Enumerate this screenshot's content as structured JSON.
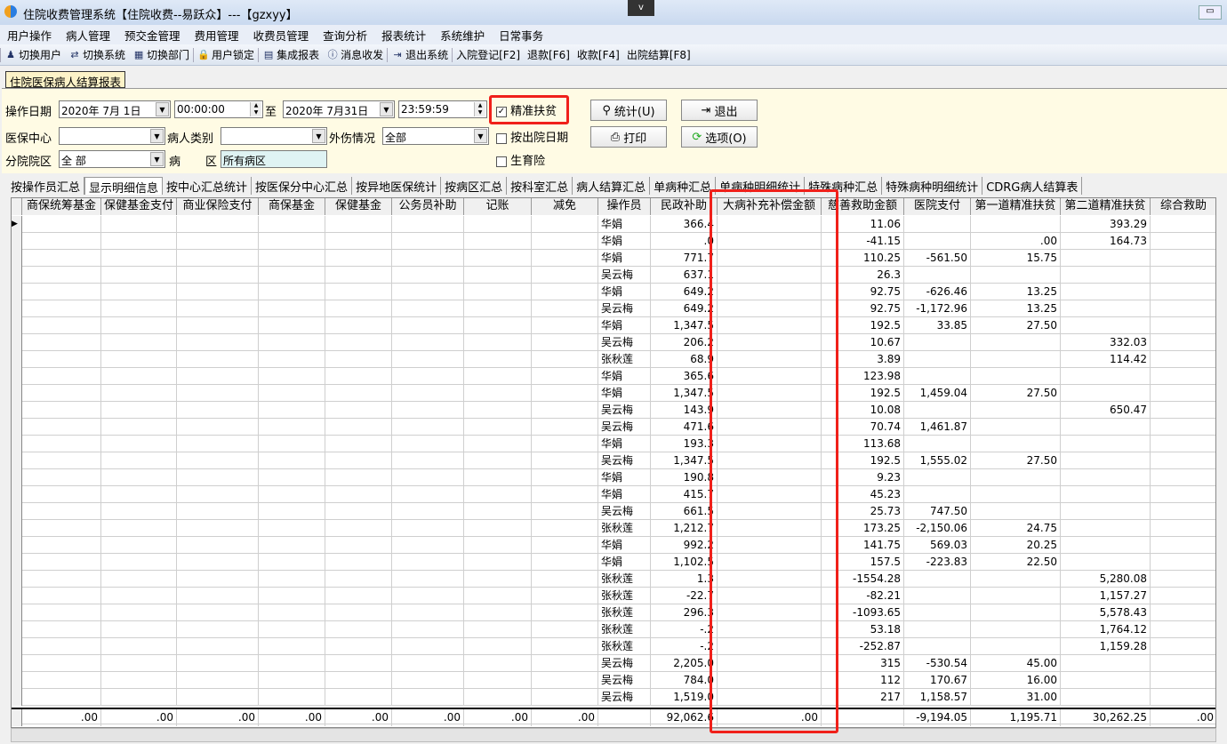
{
  "window": {
    "title": "住院收费管理系统【住院收费--易跃众】---【gzxyy】",
    "dropdown": "v",
    "minimize": "▭"
  },
  "menu": [
    "用户操作",
    "病人管理",
    "预交金管理",
    "费用管理",
    "收费员管理",
    "查询分析",
    "报表统计",
    "系统维护",
    "日常事务"
  ],
  "toolbar": [
    {
      "icon": "switch-user-icon",
      "g": "♟",
      "label": "切换用户"
    },
    {
      "icon": "switch-system-icon",
      "g": "⇄",
      "label": "切换系统"
    },
    {
      "icon": "switch-dept-icon",
      "g": "▦",
      "label": "切换部门"
    },
    {
      "icon": "user-lock-icon",
      "g": "🔒",
      "label": "用户锁定"
    },
    {
      "icon": "report-icon",
      "g": "▤",
      "label": "集成报表"
    },
    {
      "icon": "info-icon",
      "g": "ⓘ",
      "label": "消息收发"
    },
    {
      "icon": "exit-icon",
      "g": "⇥",
      "label": "退出系统"
    },
    {
      "label": "入院登记[F2]"
    },
    {
      "label": "退款[F6]"
    },
    {
      "label": "收款[F4]"
    },
    {
      "label": "出院结算[F8]"
    }
  ],
  "doc_tab": "住院医保病人结算报表",
  "filter": {
    "op_date_label": "操作日期",
    "date_from": "2020年  7月  1日",
    "time_from": "00:00:00",
    "to_label": "至",
    "date_to": "2020年  7月31日",
    "time_to": "23:59:59",
    "precise_label": "精准扶贫",
    "precise_checked": "✓",
    "center_label": "医保中心",
    "center_value": "",
    "patient_type_label": "病人类别",
    "patient_type_value": "",
    "injury_label": "外伤情况",
    "injury_value": "全部",
    "discharge_label": "按出院日期",
    "branch_label": "分院院区",
    "branch_value": "全 部",
    "ward_label1": "病",
    "ward_label2": "区",
    "ward_value": "所有病区",
    "maternity_label": "生育险",
    "stat_btn": "统计(U)",
    "exit_btn": "退出",
    "print_btn": "打印",
    "options_btn": "选项(O)"
  },
  "tabs": [
    "按操作员汇总",
    "显示明细信息",
    "按中心汇总统计",
    "按医保分中心汇总",
    "按异地医保统计",
    "按病区汇总",
    "按科室汇总",
    "病人结算汇总",
    "单病种汇总",
    "单病种明细统计",
    "特殊病种汇总",
    "特殊病种明细统计",
    "CDRG病人结算表"
  ],
  "active_tab": 1,
  "columns": [
    "商保统筹基金",
    "保健基金支付",
    "商业保险支付",
    "商保基金",
    "保健基金",
    "公务员补助",
    "记账",
    "减免",
    "操作员",
    "民政补助",
    "大病补充补偿金额",
    "慈善救助金额",
    "医院支付",
    "第一道精准扶贫",
    "第二道精准扶贫",
    "综合救助"
  ],
  "rows": [
    [
      "华娟",
      "366.4",
      "",
      "11.06",
      "",
      "",
      "393.29"
    ],
    [
      "华娟",
      ".0",
      "",
      "-41.15",
      "",
      ".00",
      "164.73"
    ],
    [
      "华娟",
      "771.7",
      "",
      "110.25",
      "-561.50",
      "15.75",
      ""
    ],
    [
      "吴云梅",
      "637.1",
      "",
      "26.3",
      "",
      "",
      ""
    ],
    [
      "华娟",
      "649.2",
      "",
      "92.75",
      "-626.46",
      "13.25",
      ""
    ],
    [
      "吴云梅",
      "649.2",
      "",
      "92.75",
      "-1,172.96",
      "13.25",
      ""
    ],
    [
      "华娟",
      "1,347.5",
      "",
      "192.5",
      "33.85",
      "27.50",
      ""
    ],
    [
      "吴云梅",
      "206.2",
      "",
      "10.67",
      "",
      "",
      "332.03"
    ],
    [
      "张秋莲",
      "68.9",
      "",
      "3.89",
      "",
      "",
      "114.42"
    ],
    [
      "华娟",
      "365.6",
      "",
      "123.98",
      "",
      "",
      ""
    ],
    [
      "华娟",
      "1,347.5",
      "",
      "192.5",
      "1,459.04",
      "27.50",
      ""
    ],
    [
      "吴云梅",
      "143.9",
      "",
      "10.08",
      "",
      "",
      "650.47"
    ],
    [
      "吴云梅",
      "471.6",
      "",
      "70.74",
      "1,461.87",
      "",
      ""
    ],
    [
      "华娟",
      "193.3",
      "",
      "113.68",
      "",
      "",
      ""
    ],
    [
      "吴云梅",
      "1,347.5",
      "",
      "192.5",
      "1,555.02",
      "27.50",
      ""
    ],
    [
      "华娟",
      "190.8",
      "",
      "9.23",
      "",
      "",
      ""
    ],
    [
      "华娟",
      "415.7",
      "",
      "45.23",
      "",
      "",
      ""
    ],
    [
      "吴云梅",
      "661.5",
      "",
      "25.73",
      "747.50",
      "",
      ""
    ],
    [
      "张秋莲",
      "1,212.7",
      "",
      "173.25",
      "-2,150.06",
      "24.75",
      ""
    ],
    [
      "华娟",
      "992.2",
      "",
      "141.75",
      "569.03",
      "20.25",
      ""
    ],
    [
      "华娟",
      "1,102.5",
      "",
      "157.5",
      "-223.83",
      "22.50",
      ""
    ],
    [
      "张秋莲",
      "1.3",
      "",
      "-1554.28",
      "",
      "",
      "5,280.08"
    ],
    [
      "张秋莲",
      "-22.7",
      "",
      "-82.21",
      "",
      "",
      "1,157.27"
    ],
    [
      "张秋莲",
      "296.3",
      "",
      "-1093.65",
      "",
      "",
      "5,578.43"
    ],
    [
      "张秋莲",
      "-.2",
      "",
      "53.18",
      "",
      "",
      "1,764.12"
    ],
    [
      "张秋莲",
      "-.2",
      "",
      "-252.87",
      "",
      "",
      "1,159.28"
    ],
    [
      "吴云梅",
      "2,205.0",
      "",
      "315",
      "-530.54",
      "45.00",
      ""
    ],
    [
      "吴云梅",
      "784.0",
      "",
      "112",
      "170.67",
      "16.00",
      ""
    ],
    [
      "吴云梅",
      "1,519.0",
      "",
      "217",
      "1,158.57",
      "31.00",
      ""
    ]
  ],
  "totals": [
    ".00",
    ".00",
    ".00",
    ".00",
    ".00",
    ".00",
    ".00",
    ".00",
    "",
    "92,062.6",
    ".00",
    "",
    "-9,194.05",
    "1,195.71",
    "30,262.25",
    ".00"
  ],
  "highlight_color": "#f0201a"
}
